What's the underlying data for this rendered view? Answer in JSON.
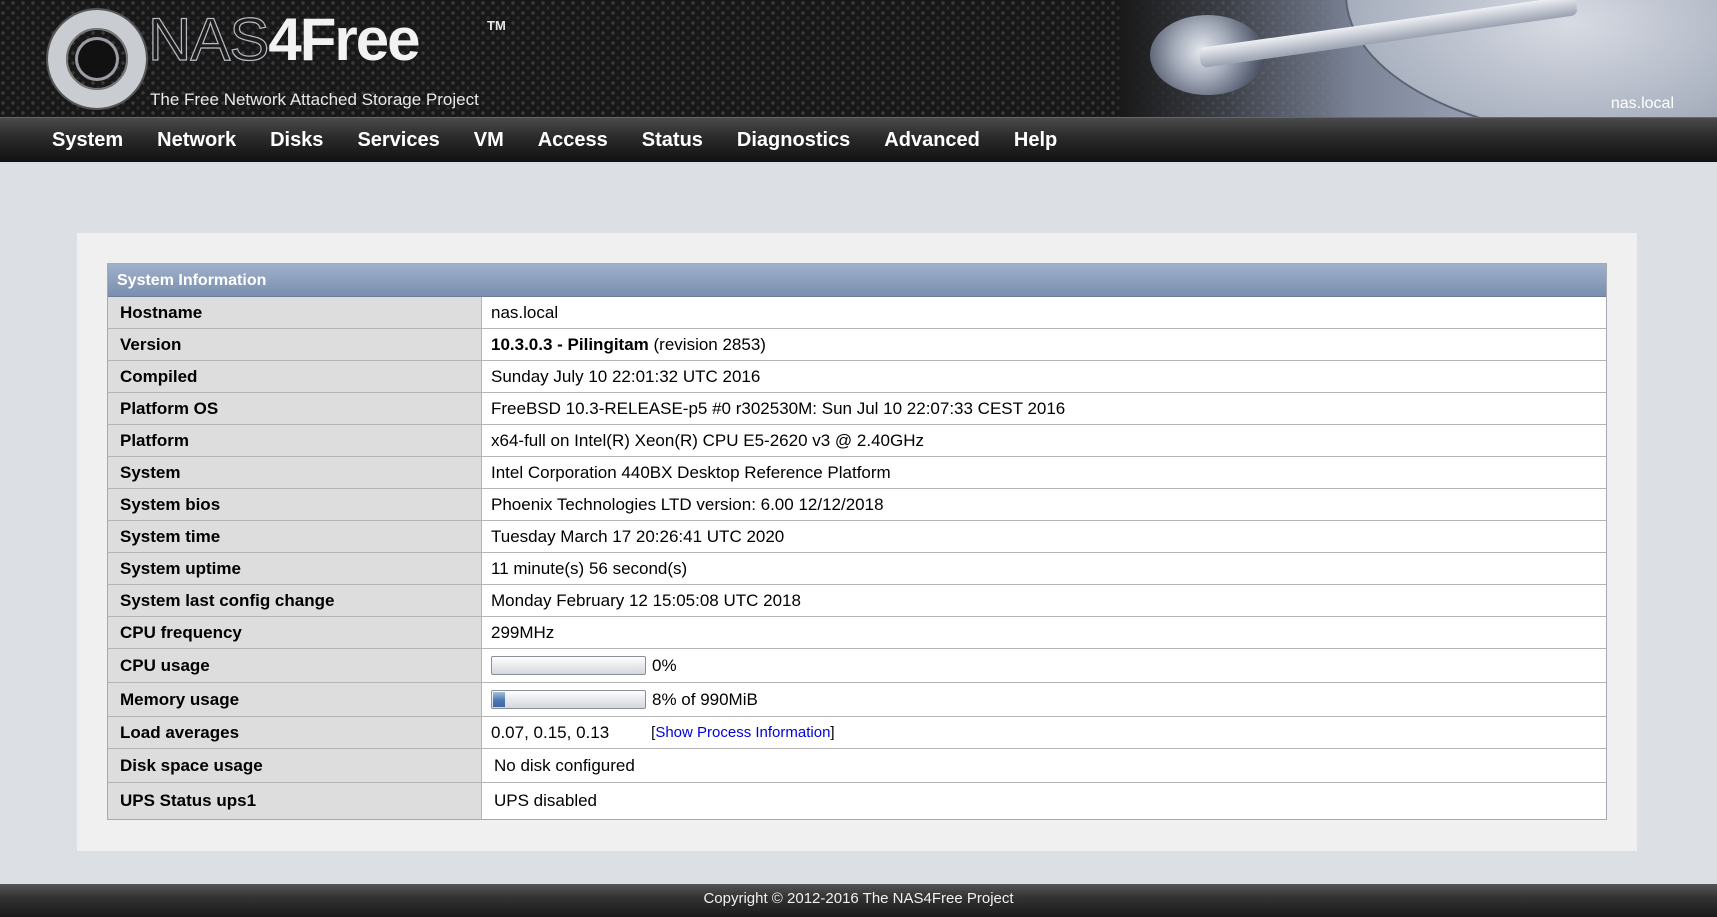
{
  "header": {
    "logo_name_light": "NAS",
    "logo_name_bold": "4Free",
    "logo_tm": "TM",
    "tagline": "The Free Network Attached Storage Project",
    "hostname": "nas.local"
  },
  "nav": {
    "items": [
      "System",
      "Network",
      "Disks",
      "Services",
      "VM",
      "Access",
      "Status",
      "Diagnostics",
      "Advanced",
      "Help"
    ]
  },
  "system_info": {
    "title": "System Information",
    "rows": [
      {
        "label": "Hostname",
        "value": "nas.local"
      },
      {
        "label": "Version",
        "value_bold": "10.3.0.3 - Pilingitam",
        "value_rest": "(revision 2853)"
      },
      {
        "label": "Compiled",
        "value": "Sunday July 10 22:01:32 UTC 2016"
      },
      {
        "label": "Platform OS",
        "value": "FreeBSD 10.3-RELEASE-p5 #0 r302530M: Sun Jul 10 22:07:33 CEST 2016"
      },
      {
        "label": "Platform",
        "value": "x64-full on Intel(R) Xeon(R) CPU E5-2620 v3 @ 2.40GHz"
      },
      {
        "label": "System",
        "value": "Intel Corporation 440BX Desktop Reference Platform"
      },
      {
        "label": "System bios",
        "value": "Phoenix Technologies LTD version: 6.00 12/12/2018"
      },
      {
        "label": "System time",
        "value": "Tuesday March 17 20:26:41 UTC 2020"
      },
      {
        "label": "System uptime",
        "value": "11 minute(s) 56 second(s)"
      },
      {
        "label": "System last config change",
        "value": "Monday February 12 15:05:08 UTC 2018"
      },
      {
        "label": "CPU frequency",
        "value": "299MHz"
      },
      {
        "label": "CPU usage",
        "value": "0%",
        "percent": 0
      },
      {
        "label": "Memory usage",
        "value": "8% of 990MiB",
        "percent": 8
      },
      {
        "label": "Load averages",
        "value": "0.07, 0.15, 0.13",
        "link_open": "[",
        "link_text": "Show Process Information",
        "link_close": "]"
      },
      {
        "label": "Disk space usage",
        "value": "No disk configured"
      },
      {
        "label": "UPS Status ups1",
        "value": "UPS disabled"
      }
    ]
  },
  "footer": {
    "copyright": "Copyright © 2012-2016 The NAS4Free Project"
  }
}
